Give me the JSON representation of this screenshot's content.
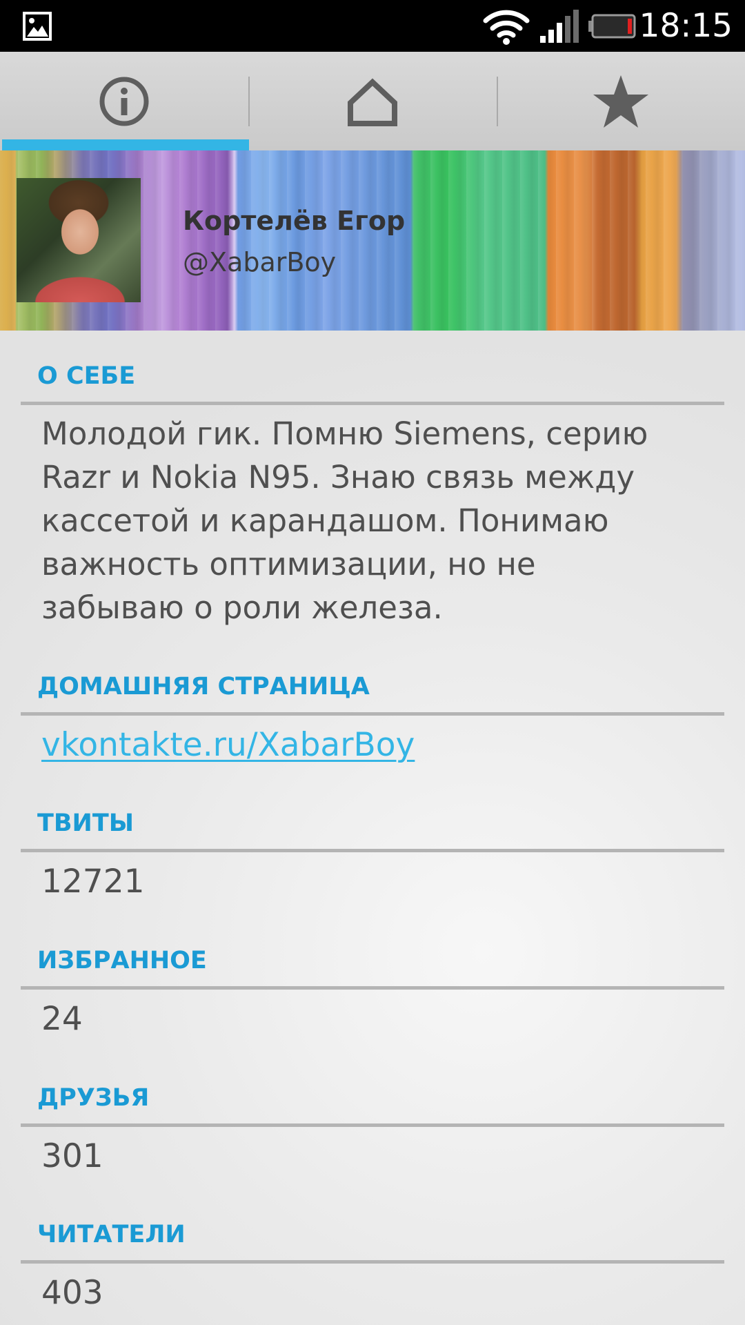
{
  "status_bar": {
    "time": "18:15",
    "icons": [
      "image-notification-icon",
      "wifi-icon",
      "signal-icon",
      "battery-icon"
    ]
  },
  "tabs": [
    {
      "icon": "info-icon",
      "selected": true
    },
    {
      "icon": "home-icon",
      "selected": false
    },
    {
      "icon": "star-icon",
      "selected": false
    }
  ],
  "profile": {
    "name": "Кортелёв Егор",
    "handle": "@XabarBoy"
  },
  "sections": {
    "about": {
      "header": "О СЕБЕ",
      "lines": [
        "Молодой гик. Помню Siemens, серию",
        "Razr и Nokia N95. Знаю связь между",
        "кассетой и карандашом. Понимаю",
        "важность оптимизации, но не",
        "забываю о роли железа."
      ]
    },
    "homepage": {
      "header": "ДОМАШНЯЯ СТРАНИЦА",
      "value": "vkontakte.ru/XabarBoy"
    },
    "tweets": {
      "header": "ТВИТЫ",
      "value": "12721"
    },
    "favorites": {
      "header": "ИЗБРАННОЕ",
      "value": "24"
    },
    "friends": {
      "header": "ДРУЗЬЯ",
      "value": "301"
    },
    "followers": {
      "header": "ЧИТАТЕЛИ",
      "value": "403"
    }
  },
  "colors": {
    "accent": "#33b5e5",
    "section_header": "#1a9ad4",
    "value_text": "#4f4f4f"
  }
}
